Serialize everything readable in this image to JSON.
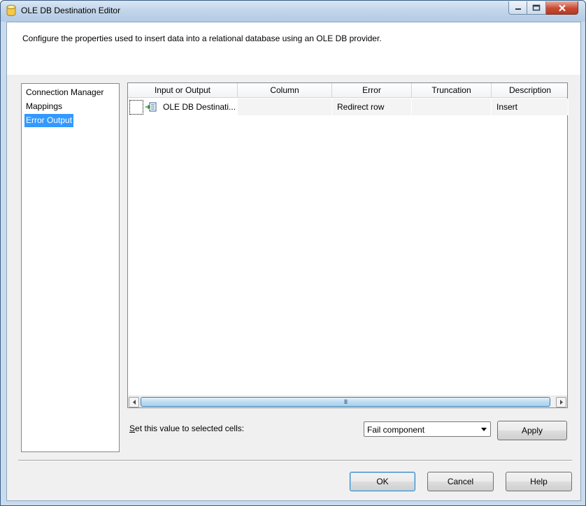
{
  "window": {
    "title": "OLE DB Destination Editor",
    "icon": "database-cylinder-icon"
  },
  "description": "Configure the properties used to insert data into a relational database using an OLE DB provider.",
  "nav": {
    "items": [
      {
        "label": "Connection Manager",
        "selected": false
      },
      {
        "label": "Mappings",
        "selected": false
      },
      {
        "label": "Error Output",
        "selected": true
      }
    ]
  },
  "grid": {
    "columns": [
      "Input or Output",
      "Column",
      "Error",
      "Truncation",
      "Description"
    ],
    "rows": [
      {
        "icon": "input-output-icon",
        "input_or_output": "OLE DB Destinati...",
        "column": "",
        "error": "Redirect row",
        "truncation": "",
        "description": "Insert"
      }
    ],
    "scroll_grip": "III"
  },
  "set_value": {
    "label": "Set this value to selected cells:",
    "selected_option": "Fail component"
  },
  "buttons": {
    "apply": "Apply",
    "ok": "OK",
    "cancel": "Cancel",
    "help": "Help"
  },
  "colors": {
    "selection": "#3399ff",
    "client_background": "#f0f0f0",
    "frame": "#c9dbee"
  }
}
